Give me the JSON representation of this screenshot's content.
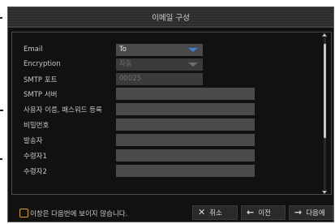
{
  "dialog": {
    "title": "이메일 구성"
  },
  "form": {
    "rows": [
      {
        "label": "Email",
        "value": "To"
      },
      {
        "label": "Encryption",
        "value": "자동"
      },
      {
        "label": "SMTP 포트",
        "value": "00025"
      },
      {
        "label": "SMTP 서버",
        "value": ""
      },
      {
        "label": "사용자 이름, 패스워드 등록",
        "value": ""
      },
      {
        "label": "비밀번호",
        "value": ""
      },
      {
        "label": "발송자",
        "value": ""
      },
      {
        "label": "수령자1",
        "value": ""
      },
      {
        "label": "수령자2",
        "value": ""
      }
    ]
  },
  "footer": {
    "dont_show_label": "이창은 다음번에 보이지 않습니다.",
    "cancel": {
      "icon": "✕",
      "label": "취소"
    },
    "prev": {
      "icon": "←",
      "label": "이전"
    },
    "next": {
      "icon": "→",
      "label": "다음에"
    }
  },
  "colors": {
    "accent": "#3c7fd6",
    "checkbox_border": "#d9a21a"
  },
  "icons": [
    "chevron-down-icon",
    "close-icon",
    "arrow-left-icon",
    "arrow-right-icon"
  ]
}
